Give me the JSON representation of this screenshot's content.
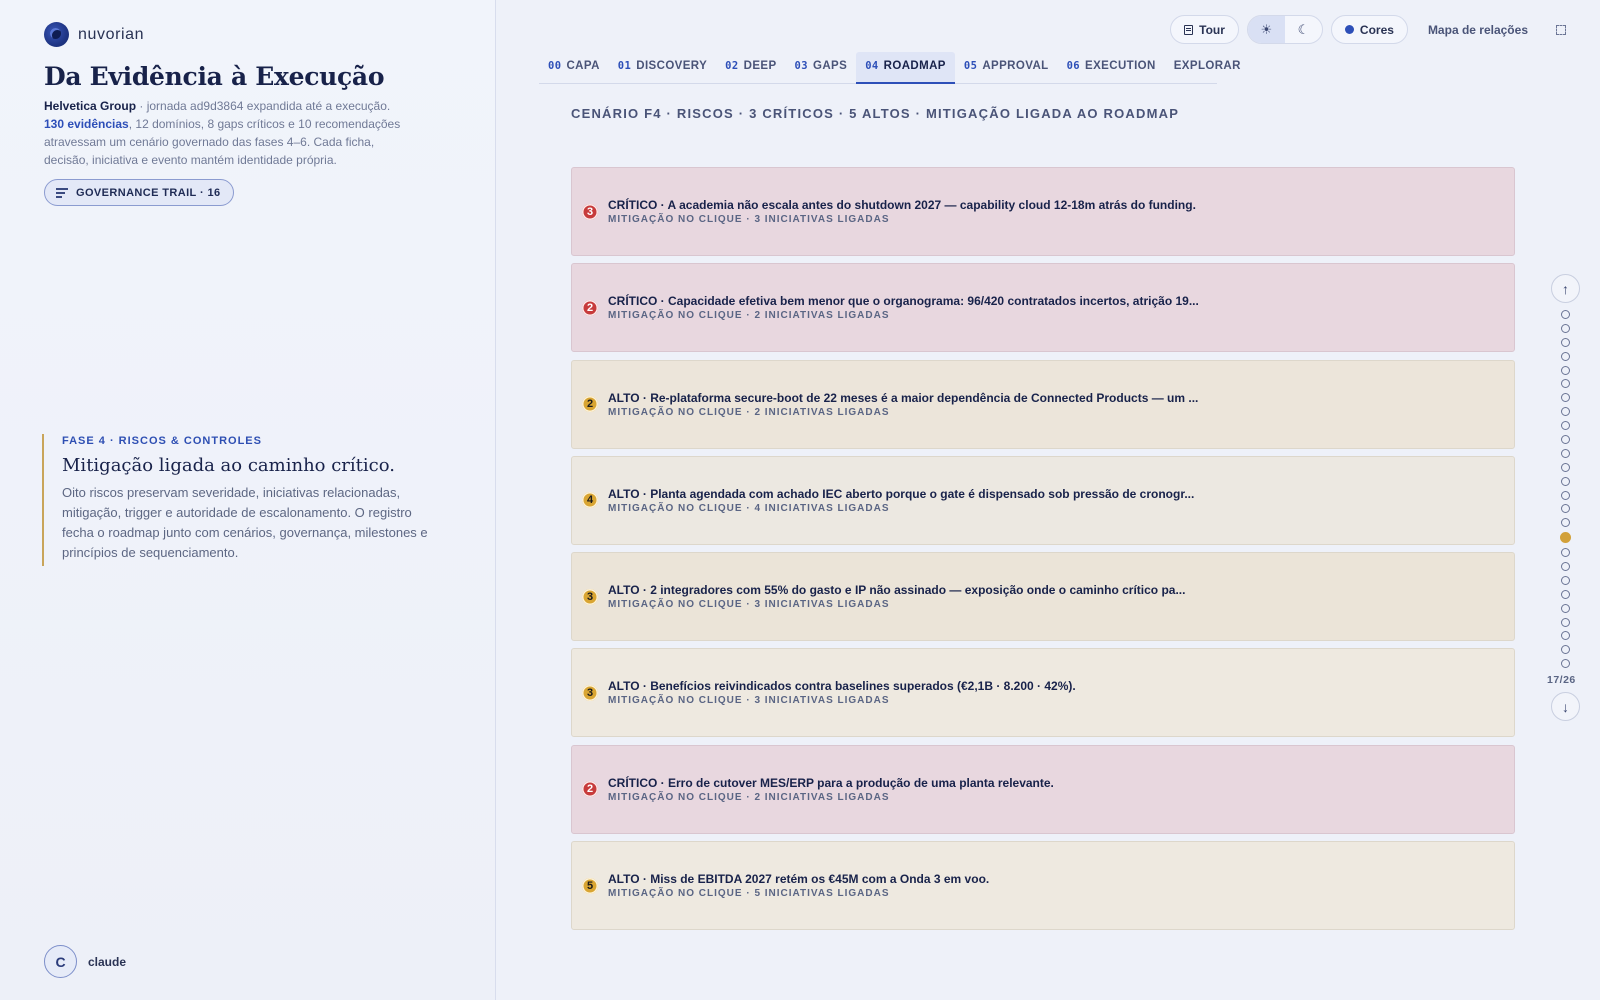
{
  "brand": {
    "name": "nuvorian"
  },
  "left": {
    "title": "Da Evidência à Execução",
    "intro": {
      "company": "Helvetica Group",
      "journey": " · jornada ad9d3864 expandida até a execução.",
      "evidence": "130 evidências",
      "summary": ", 12 domínios, 8 gaps críticos e 10 recomendações atravessam um cenário governado das fases 4–6. Cada ficha, decisão, iniciativa e evento mantém identidade própria."
    },
    "trail_button": "GOVERNANCE TRAIL · 16",
    "phase": {
      "eyebrow": "FASE 4 · RISCOS & CONTROLES",
      "title": "Mitigação ligada ao caminho crítico.",
      "description": "Oito riscos preservam severidade, iniciativas relacionadas, mitigação, trigger e autoridade de escalonamento. O registro fecha o roadmap junto com cenários, governança, milestones e princípios de sequenciamento."
    },
    "user": {
      "initial": "C",
      "name": "claude"
    }
  },
  "topbar": {
    "tour": "Tour",
    "colors": "Cores",
    "relations": "Mapa de relações",
    "accent_color": "#2d4fb8"
  },
  "tabs": [
    {
      "num": "00",
      "label": "CAPA"
    },
    {
      "num": "01",
      "label": "DISCOVERY"
    },
    {
      "num": "02",
      "label": "DEEP"
    },
    {
      "num": "03",
      "label": "GAPS"
    },
    {
      "num": "04",
      "label": "ROADMAP",
      "active": true
    },
    {
      "num": "05",
      "label": "APPROVAL"
    },
    {
      "num": "06",
      "label": "EXECUTION"
    },
    {
      "num": "",
      "label": "EXPLORAR"
    }
  ],
  "scenario_heading": "CENÁRIO F4 · RISCOS · 3 CRÍTICOS · 5 ALTOS · MITIGAÇÃO LIGADA AO ROADMAP",
  "risks": [
    {
      "level": "critico",
      "count": "3",
      "title": "CRÍTICO · A academia não escala antes do shutdown 2027 — capability cloud 12-18m atrás do funding.",
      "sub": "MITIGAÇÃO NO CLIQUE · 3 INICIATIVAS LIGADAS"
    },
    {
      "level": "critico",
      "count": "2",
      "title": "CRÍTICO · Capacidade efetiva bem menor que o organograma: 96/420 contratados incertos, atrição 19...",
      "sub": "MITIGAÇÃO NO CLIQUE · 2 INICIATIVAS LIGADAS"
    },
    {
      "level": "alto",
      "count": "2",
      "title": "ALTO · Re-plataforma secure-boot de 22 meses é a maior dependência de Connected Products — um ...",
      "sub": "MITIGAÇÃO NO CLIQUE · 2 INICIATIVAS LIGADAS"
    },
    {
      "level": "alto",
      "count": "4",
      "title": "ALTO · Planta agendada com achado IEC aberto porque o gate é dispensado sob pressão de cronogr...",
      "sub": "MITIGAÇÃO NO CLIQUE · 4 INICIATIVAS LIGADAS"
    },
    {
      "level": "alto",
      "count": "3",
      "title": "ALTO · 2 integradores com 55% do gasto e IP não assinado — exposição onde o caminho crítico pa...",
      "sub": "MITIGAÇÃO NO CLIQUE · 3 INICIATIVAS LIGADAS"
    },
    {
      "level": "alto",
      "count": "3",
      "title": "ALTO · Benefícios reivindicados contra baselines superados (€2,1B · 8.200 · 42%).",
      "sub": "MITIGAÇÃO NO CLIQUE · 3 INICIATIVAS LIGADAS"
    },
    {
      "level": "critico",
      "count": "2",
      "title": "CRÍTICO · Erro de cutover MES/ERP para a produção de uma planta relevante.",
      "sub": "MITIGAÇÃO NO CLIQUE · 2 INICIATIVAS LIGADAS"
    },
    {
      "level": "alto",
      "count": "5",
      "title": "ALTO · Miss de EBITDA 2027 retém os €45M com a Onda 3 em voo.",
      "sub": "MITIGAÇÃO NO CLIQUE · 5 INICIATIVAS LIGADAS"
    }
  ],
  "rail": {
    "total": 26,
    "current": 17,
    "counter": "17/26",
    "active_color": "#d2a13a"
  }
}
